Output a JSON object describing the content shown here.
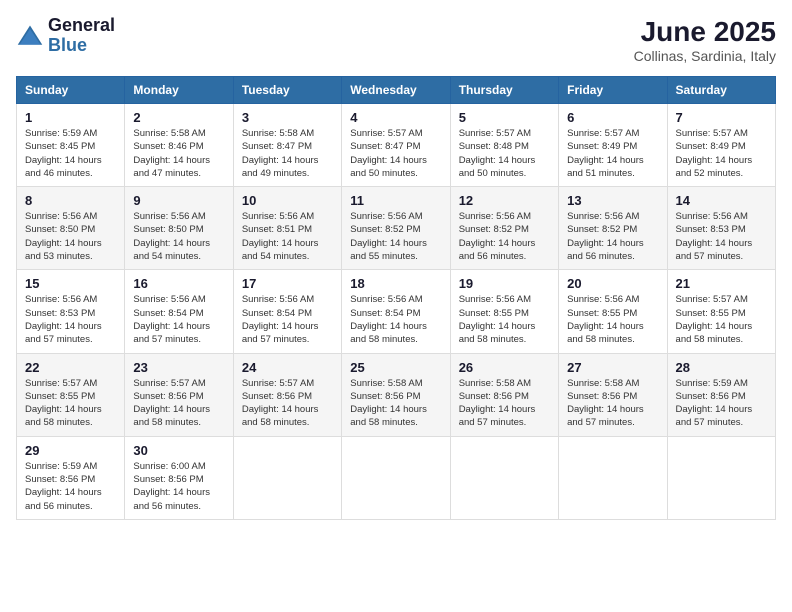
{
  "header": {
    "logo_general": "General",
    "logo_blue": "Blue",
    "month_title": "June 2025",
    "location": "Collinas, Sardinia, Italy"
  },
  "weekdays": [
    "Sunday",
    "Monday",
    "Tuesday",
    "Wednesday",
    "Thursday",
    "Friday",
    "Saturday"
  ],
  "weeks": [
    [
      {
        "day": "1",
        "sunrise": "5:59 AM",
        "sunset": "8:45 PM",
        "daylight": "14 hours and 46 minutes."
      },
      {
        "day": "2",
        "sunrise": "5:58 AM",
        "sunset": "8:46 PM",
        "daylight": "14 hours and 47 minutes."
      },
      {
        "day": "3",
        "sunrise": "5:58 AM",
        "sunset": "8:47 PM",
        "daylight": "14 hours and 49 minutes."
      },
      {
        "day": "4",
        "sunrise": "5:57 AM",
        "sunset": "8:47 PM",
        "daylight": "14 hours and 50 minutes."
      },
      {
        "day": "5",
        "sunrise": "5:57 AM",
        "sunset": "8:48 PM",
        "daylight": "14 hours and 50 minutes."
      },
      {
        "day": "6",
        "sunrise": "5:57 AM",
        "sunset": "8:49 PM",
        "daylight": "14 hours and 51 minutes."
      },
      {
        "day": "7",
        "sunrise": "5:57 AM",
        "sunset": "8:49 PM",
        "daylight": "14 hours and 52 minutes."
      }
    ],
    [
      {
        "day": "8",
        "sunrise": "5:56 AM",
        "sunset": "8:50 PM",
        "daylight": "14 hours and 53 minutes."
      },
      {
        "day": "9",
        "sunrise": "5:56 AM",
        "sunset": "8:50 PM",
        "daylight": "14 hours and 54 minutes."
      },
      {
        "day": "10",
        "sunrise": "5:56 AM",
        "sunset": "8:51 PM",
        "daylight": "14 hours and 54 minutes."
      },
      {
        "day": "11",
        "sunrise": "5:56 AM",
        "sunset": "8:52 PM",
        "daylight": "14 hours and 55 minutes."
      },
      {
        "day": "12",
        "sunrise": "5:56 AM",
        "sunset": "8:52 PM",
        "daylight": "14 hours and 56 minutes."
      },
      {
        "day": "13",
        "sunrise": "5:56 AM",
        "sunset": "8:52 PM",
        "daylight": "14 hours and 56 minutes."
      },
      {
        "day": "14",
        "sunrise": "5:56 AM",
        "sunset": "8:53 PM",
        "daylight": "14 hours and 57 minutes."
      }
    ],
    [
      {
        "day": "15",
        "sunrise": "5:56 AM",
        "sunset": "8:53 PM",
        "daylight": "14 hours and 57 minutes."
      },
      {
        "day": "16",
        "sunrise": "5:56 AM",
        "sunset": "8:54 PM",
        "daylight": "14 hours and 57 minutes."
      },
      {
        "day": "17",
        "sunrise": "5:56 AM",
        "sunset": "8:54 PM",
        "daylight": "14 hours and 57 minutes."
      },
      {
        "day": "18",
        "sunrise": "5:56 AM",
        "sunset": "8:54 PM",
        "daylight": "14 hours and 58 minutes."
      },
      {
        "day": "19",
        "sunrise": "5:56 AM",
        "sunset": "8:55 PM",
        "daylight": "14 hours and 58 minutes."
      },
      {
        "day": "20",
        "sunrise": "5:56 AM",
        "sunset": "8:55 PM",
        "daylight": "14 hours and 58 minutes."
      },
      {
        "day": "21",
        "sunrise": "5:57 AM",
        "sunset": "8:55 PM",
        "daylight": "14 hours and 58 minutes."
      }
    ],
    [
      {
        "day": "22",
        "sunrise": "5:57 AM",
        "sunset": "8:55 PM",
        "daylight": "14 hours and 58 minutes."
      },
      {
        "day": "23",
        "sunrise": "5:57 AM",
        "sunset": "8:56 PM",
        "daylight": "14 hours and 58 minutes."
      },
      {
        "day": "24",
        "sunrise": "5:57 AM",
        "sunset": "8:56 PM",
        "daylight": "14 hours and 58 minutes."
      },
      {
        "day": "25",
        "sunrise": "5:58 AM",
        "sunset": "8:56 PM",
        "daylight": "14 hours and 58 minutes."
      },
      {
        "day": "26",
        "sunrise": "5:58 AM",
        "sunset": "8:56 PM",
        "daylight": "14 hours and 57 minutes."
      },
      {
        "day": "27",
        "sunrise": "5:58 AM",
        "sunset": "8:56 PM",
        "daylight": "14 hours and 57 minutes."
      },
      {
        "day": "28",
        "sunrise": "5:59 AM",
        "sunset": "8:56 PM",
        "daylight": "14 hours and 57 minutes."
      }
    ],
    [
      {
        "day": "29",
        "sunrise": "5:59 AM",
        "sunset": "8:56 PM",
        "daylight": "14 hours and 56 minutes."
      },
      {
        "day": "30",
        "sunrise": "6:00 AM",
        "sunset": "8:56 PM",
        "daylight": "14 hours and 56 minutes."
      },
      null,
      null,
      null,
      null,
      null
    ]
  ],
  "labels": {
    "sunrise": "Sunrise:",
    "sunset": "Sunset:",
    "daylight": "Daylight:"
  }
}
